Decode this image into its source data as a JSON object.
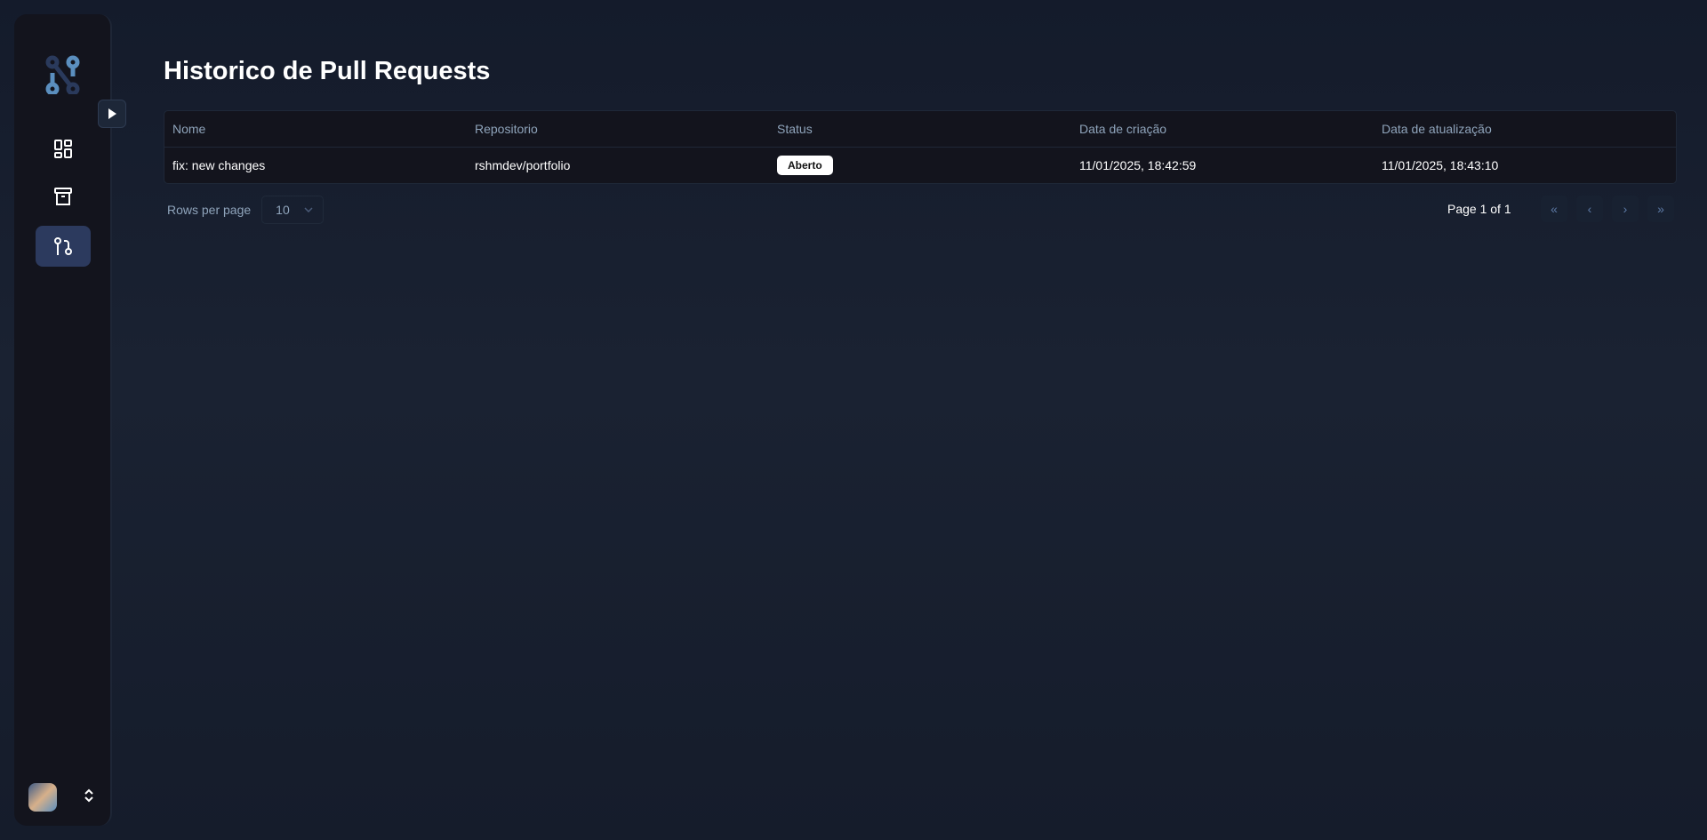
{
  "page": {
    "title": "Historico de Pull Requests"
  },
  "sidebar": {
    "items": [
      {
        "icon": "dashboard-icon"
      },
      {
        "icon": "archive-icon"
      },
      {
        "icon": "git-pull-request-icon",
        "active": true
      }
    ],
    "accent": "#5b8fbf"
  },
  "table": {
    "columns": [
      "Nome",
      "Repositorio",
      "Status",
      "Data de criação",
      "Data de atualização"
    ],
    "rows": [
      {
        "name": "fix: new changes",
        "repo": "rshmdev/portfolio",
        "status": "Aberto",
        "created": "11/01/2025, 18:42:59",
        "updated": "11/01/2025, 18:43:10"
      }
    ]
  },
  "pagination": {
    "rows_label": "Rows per page",
    "rows_value": "10",
    "page_info": "Page 1 of 1",
    "first": "«",
    "prev": "‹",
    "next": "›",
    "last": "»"
  }
}
